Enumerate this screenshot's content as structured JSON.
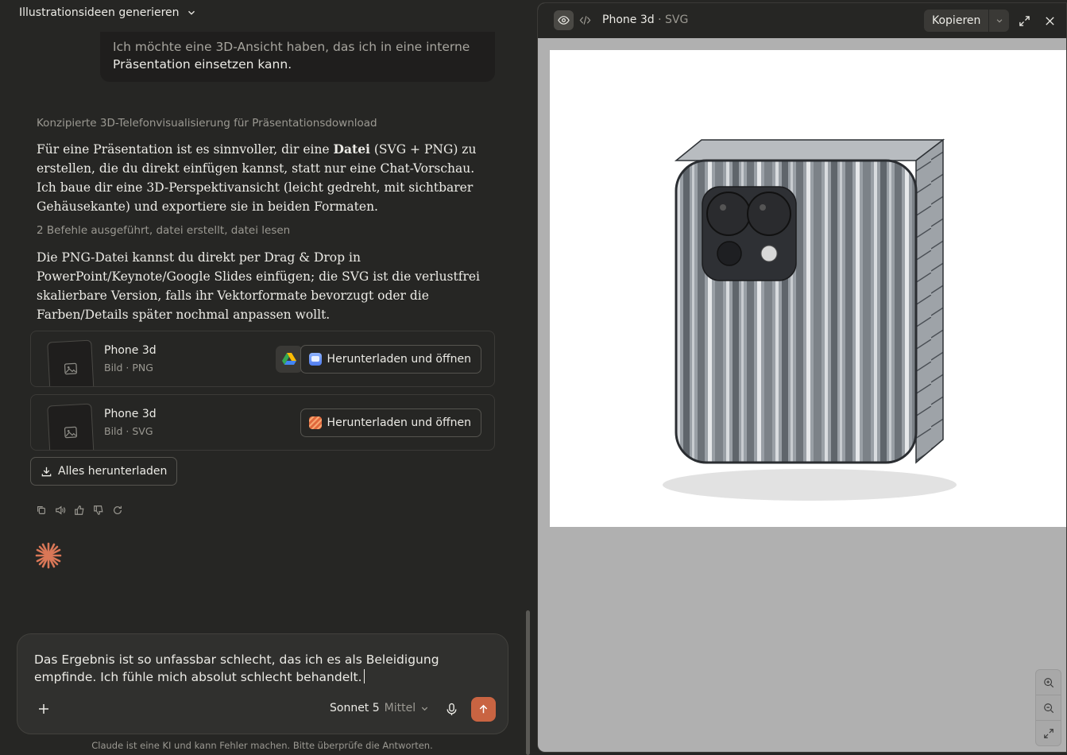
{
  "conversation": {
    "title": "Illustrationsideen generieren"
  },
  "user_message": {
    "line1": "Ich möchte eine 3D-Ansicht haben, das ich in eine interne",
    "line2": "Präsentation einsetzen kann."
  },
  "assistant": {
    "thinking_summary": "Konzipierte 3D-Telefonvisualisierung für Präsentationsdownload",
    "para1_before": "Für eine Präsentation ist es sinnvoller, dir eine ",
    "para1_bold": "Datei",
    "para1_after": " (SVG + PNG) zu erstellen, die du direkt einfügen kannst, statt nur eine Chat-Vorschau. Ich baue dir eine 3D-Perspektivansicht (leicht gedreht, mit sichtbarer Gehäusekante) und exportiere sie in beiden Formaten.",
    "tool_summary": "2 Befehle ausgeführt, datei erstellt, datei lesen",
    "para2": "Die PNG-Datei kannst du direkt per Drag & Drop in PowerPoint/Keynote/Google Slides einfügen; die SVG ist die verlustfrei skalierbare Version, falls ihr Vektorformate bevorzugt oder die Farben/Details später nochmal anpassen wollt."
  },
  "files": [
    {
      "name": "Phone 3d",
      "meta": "Bild · PNG",
      "button": "Herunterladen und öffnen",
      "icon": "google-drive-icon"
    },
    {
      "name": "Phone 3d",
      "meta": "Bild · SVG",
      "button": "Herunterladen und öffnen"
    }
  ],
  "download_all_label": "Alles herunterladen",
  "composer": {
    "text": "Das Ergebnis ist so unfassbar schlecht, das ich es als Beleidigung empfinde. Ich fühle mich absolut schlecht behandelt.",
    "model": "Sonnet 5",
    "effort": "Mittel"
  },
  "disclaimer": "Claude ist eine KI und kann Fehler machen. Bitte überprüfe die Antworten.",
  "artifact": {
    "title": "Phone 3d",
    "separator": "·",
    "format": "SVG",
    "copy_label": "Kopieren"
  },
  "colors": {
    "accent": "#c96442",
    "background": "#262624",
    "composer": "#30302e"
  }
}
